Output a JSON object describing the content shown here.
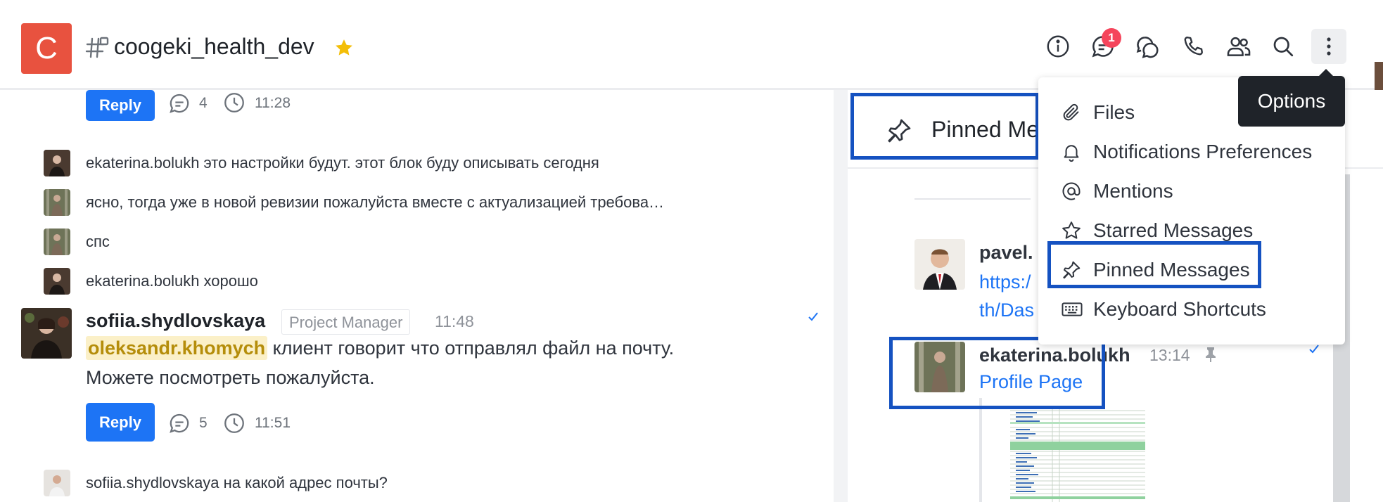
{
  "header": {
    "avatar_letter": "C",
    "room_name": "coogeki_health_dev",
    "notification_badge": "1",
    "icons": [
      "info-icon",
      "threads-icon",
      "discussion-icon",
      "call-icon",
      "members-icon",
      "search-icon",
      "kebab-icon"
    ]
  },
  "chat": {
    "thread1": {
      "reply_label": "Reply",
      "reply_count": "4",
      "last_time": "11:28"
    },
    "sequential": [
      {
        "text": "ekaterina.bolukh это настройки будут. этот блок буду описывать сегодня"
      },
      {
        "text": "ясно, тогда уже в новой ревизии пожалуйста вместе с актуализацией требова…"
      },
      {
        "text": "спс"
      },
      {
        "text": "ekaterina.bolukh хорошо"
      }
    ],
    "message": {
      "username": "sofiia.shydlovskaya",
      "role": "Project Manager",
      "time": "11:48",
      "mention": "oleksandr.khomych",
      "line1_rest": " клиент говорит что отправлял файл на почту.",
      "line2": "Можете посмотреть пожалуйста.",
      "reply_label": "Reply",
      "reply_count": "5",
      "last_time": "11:51"
    },
    "last_sequential": {
      "text": "sofiia.shydlovskaya на какой адрес почты?"
    }
  },
  "panel": {
    "title": "Pinned Me",
    "msg1": {
      "username": "pavel.",
      "link1": "https:/",
      "link2": "th/Das"
    },
    "msg2": {
      "username": "ekaterina.bolukh",
      "time": "13:14",
      "link": "Profile Page"
    }
  },
  "menu": {
    "items": [
      {
        "label": "Files",
        "icon": "paperclip-icon"
      },
      {
        "label": "Notifications Preferences",
        "icon": "bell-icon"
      },
      {
        "label": "Mentions",
        "icon": "at-icon"
      },
      {
        "label": "Starred Messages",
        "icon": "star-icon"
      },
      {
        "label": "Pinned Messages",
        "icon": "pin-icon"
      },
      {
        "label": "Keyboard Shortcuts",
        "icon": "keyboard-icon"
      }
    ],
    "tooltip": "Options"
  },
  "colors": {
    "brand_avatar": "#e8523f",
    "primary_button": "#1d74f5",
    "highlight_box": "#1552c1",
    "mention_bg": "#fbf0c8",
    "mention_text": "#b58d0a",
    "badge": "#f5455c",
    "star": "#f3be08"
  }
}
